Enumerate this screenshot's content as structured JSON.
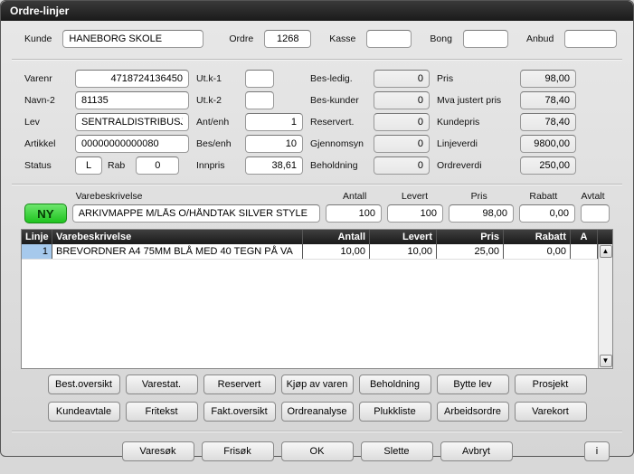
{
  "window": {
    "title": "Ordre-linjer"
  },
  "top": {
    "kunde_label": "Kunde",
    "kunde": "HANEBORG SKOLE",
    "ordre_label": "Ordre",
    "ordre": "1268",
    "kasse_label": "Kasse",
    "kasse": "",
    "bong_label": "Bong",
    "bong": "",
    "anbud_label": "Anbud",
    "anbud": ""
  },
  "left": {
    "varenr_label": "Varenr",
    "varenr": "4718724136450",
    "navn2_label": "Navn-2",
    "navn2": "81135",
    "lev_label": "Lev",
    "lev": "SENTRALDISTRIBUSJON",
    "artikkel_label": "Artikkel",
    "artikkel": "00000000000080",
    "status_label": "Status",
    "status": "L",
    "rab_label": "Rab",
    "rab": "0"
  },
  "mid": {
    "utk1_label": "Ut.k-1",
    "utk1": "",
    "utk2_label": "Ut.k-2",
    "utk2": "",
    "antenh_label": "Ant/enh",
    "antenh": "1",
    "besenh_label": "Bes/enh",
    "besenh": "10",
    "innpris_label": "Innpris",
    "innpris": "38,61"
  },
  "right1": {
    "besledig_label": "Bes-ledig.",
    "besledig": "0",
    "beskunder_label": "Bes-kunder",
    "beskunder": "0",
    "reservert_label": "Reservert.",
    "reservert": "0",
    "gjennomsyn_label": "Gjennomsyn",
    "gjennomsyn": "0",
    "beholdning_label": "Beholdning",
    "beholdning": "0"
  },
  "right2": {
    "pris_label": "Pris",
    "pris": "98,00",
    "mva_label": "Mva justert pris",
    "mva": "78,40",
    "kundepris_label": "Kundepris",
    "kundepris": "78,40",
    "linjeverdi_label": "Linjeverdi",
    "linjeverdi": "9800,00",
    "ordreverdi_label": "Ordreverdi",
    "ordreverdi": "250,00"
  },
  "entry": {
    "varebeskrivelse_label": "Varebeskrivelse",
    "antall_label": "Antall",
    "levert_label": "Levert",
    "pris_label": "Pris",
    "rabatt_label": "Rabatt",
    "avtalt_label": "Avtalt",
    "ny_label": "NY",
    "varebeskrivelse": "ARKIVMAPPE M/LÅS O/HÅNDTAK SILVER STYLE",
    "antall": "100",
    "levert": "100",
    "pris": "98,00",
    "rabatt": "0,00",
    "avtalt": ""
  },
  "table": {
    "headers": {
      "linje": "Linje",
      "vbesk": "Varebeskrivelse",
      "antall": "Antall",
      "levert": "Levert",
      "pris": "Pris",
      "rabatt": "Rabatt",
      "a": "A"
    },
    "rows": [
      {
        "linje": "1",
        "vbesk": "BREVORDNER A4 75MM BLÅ MED 40 TEGN PÅ VA",
        "antall": "10,00",
        "levert": "10,00",
        "pris": "25,00",
        "rabatt": "0,00",
        "a": ""
      }
    ]
  },
  "buttons": {
    "row1": [
      "Best.oversikt",
      "Varestat.",
      "Reservert",
      "Kjøp av varen",
      "Beholdning",
      "Bytte lev",
      "Prosjekt"
    ],
    "row2": [
      "Kundeavtale",
      "Fritekst",
      "Fakt.oversikt",
      "Ordreanalyse",
      "Plukkliste",
      "Arbeidsordre",
      "Varekort"
    ],
    "bottom": [
      "Varesøk",
      "Frisøk",
      "OK",
      "Slette",
      "Avbryt"
    ],
    "info": "i"
  }
}
